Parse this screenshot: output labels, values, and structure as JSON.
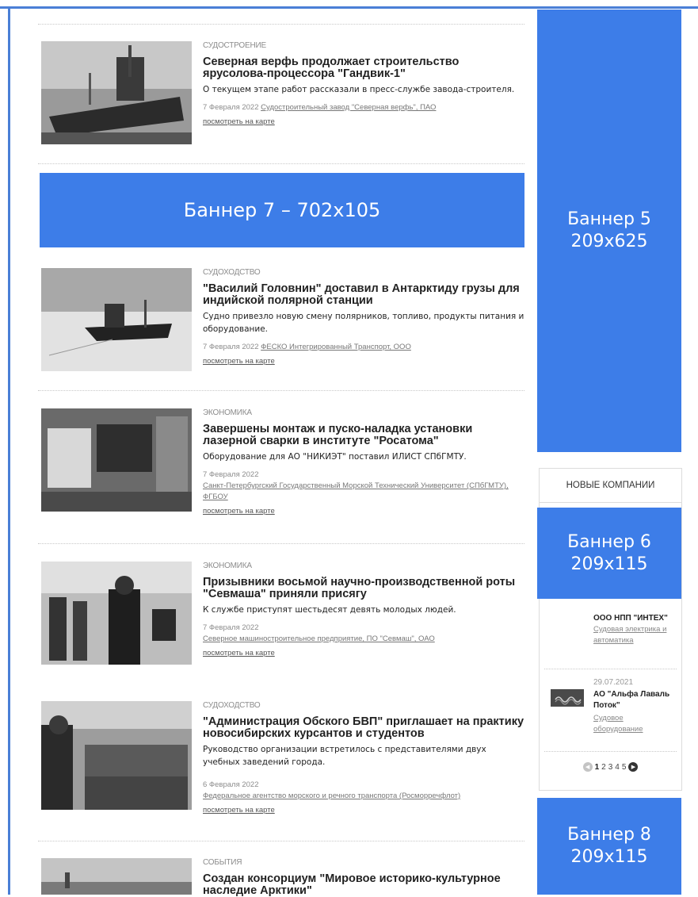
{
  "feed": [
    {
      "category": "СУДОСТРОЕНИЕ",
      "title": "Северная верфь продолжает строительство ярусолова-процессора \"Гандвик-1\"",
      "summary": "О текущем этапе работ рассказали в пресс-службе завода-строителя.",
      "date": "7 Февраля 2022",
      "company": "Судостроительный завод \"Северная верфь\", ПАО",
      "map_link": "посмотреть на карте"
    },
    {
      "category": "СУДОХОДСТВО",
      "title": "\"Василий Головнин\" доставил в Антарктиду грузы для индийской полярной станции",
      "summary": "Судно привезло новую смену полярников, топливо, продукты питания и оборудование.",
      "date": "7 Февраля 2022",
      "company": "ФЕСКО Интегрированный Транспорт, ООО",
      "map_link": "посмотреть на карте"
    },
    {
      "category": "ЭКОНОМИКА",
      "title": "Завершены монтаж и пуско-наладка установки лазерной сварки в институте \"Росатома\"",
      "summary": "Оборудование для АО \"НИКИЭТ\" поставил ИЛИСТ СПбГМТУ.",
      "date": "7 Февраля 2022",
      "company": "Санкт-Петербургский Государственный Морской Технический Университет (СПбГМТУ), ФГБОУ",
      "map_link": "посмотреть на карте"
    },
    {
      "category": "ЭКОНОМИКА",
      "title": "Призывники восьмой научно-производственной роты \"Севмаша\" приняли присягу",
      "summary": "К службе приступят шестьдесят девять молодых людей.",
      "date": "7 Февраля 2022",
      "company": "Северное машиностроительное предприятие, ПО \"Севмаш\", ОАО",
      "map_link": "посмотреть на карте"
    },
    {
      "category": "СУДОХОДСТВО",
      "title": "\"Администрация Обского БВП\" приглашает на практику новосибирских курсантов и студентов",
      "summary": "Руководство организации встретилось с представителями двух учебных заведений города.",
      "date": "6 Февраля 2022",
      "company": "Федеральное агентство морского и речного транспорта (Росморречфлот)",
      "map_link": "посмотреть на карте"
    },
    {
      "category": "СОБЫТИЯ",
      "title": "Создан консорциум \"Мировое историко-культурное наследие Арктики\""
    }
  ],
  "banners": {
    "b7": "Баннер 7 – 702x105",
    "b5_line1": "Баннер 5",
    "b5_line2": "209x625",
    "b6_line1": "Баннер 6",
    "b6_line2": "209x115",
    "b8_line1": "Баннер 8",
    "b8_line2": "209x115"
  },
  "new_companies": {
    "heading": "НОВЫЕ КОМПАНИИ",
    "items": [
      {
        "name": "ООО НПП \"ИНТЕХ\"",
        "category": "Судовая электрика и автоматика"
      },
      {
        "date": "29.07.2021",
        "name": "АО \"Альфа Лаваль Поток\"",
        "category": "Судовое оборудование"
      }
    ],
    "pages": [
      "1",
      "2",
      "3",
      "4",
      "5"
    ]
  }
}
